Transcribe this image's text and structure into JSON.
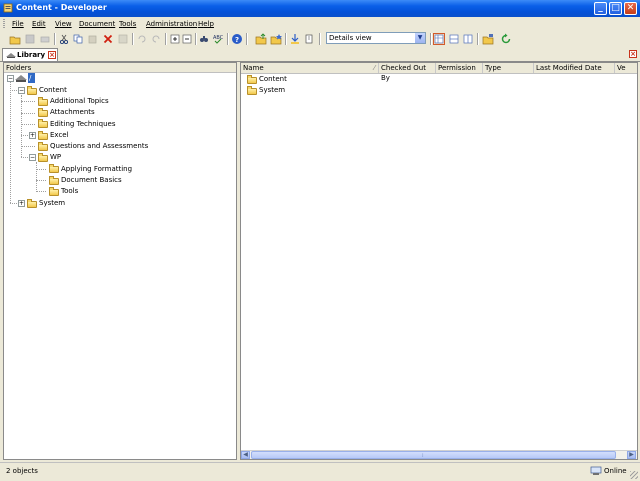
{
  "window": {
    "title": "Content - Developer",
    "minimize_glyph": "_",
    "maximize_glyph": "□",
    "close_glyph": "✕"
  },
  "menu": [
    "File",
    "Edit",
    "View",
    "Document",
    "Tools",
    "Administration",
    "Help"
  ],
  "toolbar": {
    "view_select_value": "Details view"
  },
  "tabs": {
    "library_label": "Library"
  },
  "left_panel": {
    "header": "Folders",
    "tree": {
      "root": "/",
      "content": "Content",
      "additional_topics": "Additional Topics",
      "attachments": "Attachments",
      "editing_techniques": "Editing Techniques",
      "excel": "Excel",
      "questions": "Questions and Assessments",
      "wp": "WP",
      "applying_formatting": "Applying Formatting",
      "document_basics": "Document Basics",
      "tools": "Tools",
      "system": "System"
    }
  },
  "right_panel": {
    "columns": [
      "Name",
      "Checked Out By",
      "Permission",
      "Type",
      "Last Modified Date",
      "Ve"
    ],
    "rows": [
      "Content",
      "System"
    ]
  },
  "status": {
    "count": "2 objects",
    "online": "Online"
  },
  "colors": {
    "title_blue": "#0451D8",
    "chrome": "#ECE9D8",
    "folder": "#F2C84B",
    "close_red": "#C8341C"
  }
}
